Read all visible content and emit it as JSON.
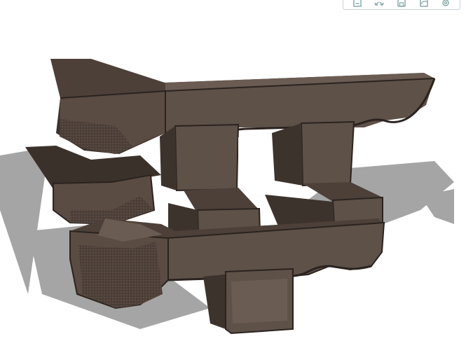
{
  "viewer": {
    "background_color": "#ffffff",
    "model_color": "#5e5148",
    "model_shadow_color": "#a5a5a5"
  },
  "toolbar": {
    "buttons": [
      {
        "icon": "export-icon"
      },
      {
        "icon": "fullscreen-icon"
      },
      {
        "icon": "save-icon"
      },
      {
        "icon": "image-icon"
      },
      {
        "icon": "gear-icon"
      }
    ],
    "icon_color": "#7fa7a4"
  }
}
